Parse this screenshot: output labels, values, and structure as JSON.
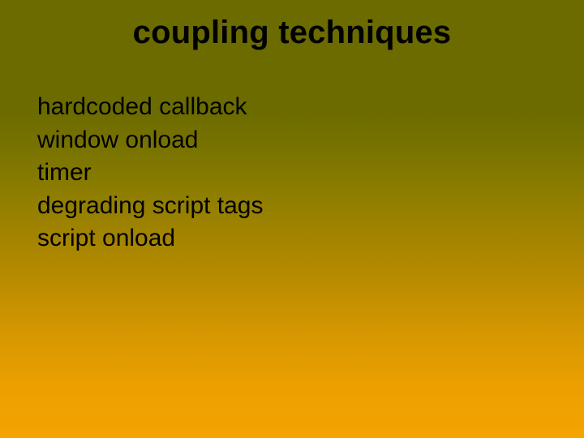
{
  "title": "coupling techniques",
  "items": [
    "hardcoded callback",
    "window onload",
    "timer",
    "degrading script tags",
    "script onload"
  ]
}
